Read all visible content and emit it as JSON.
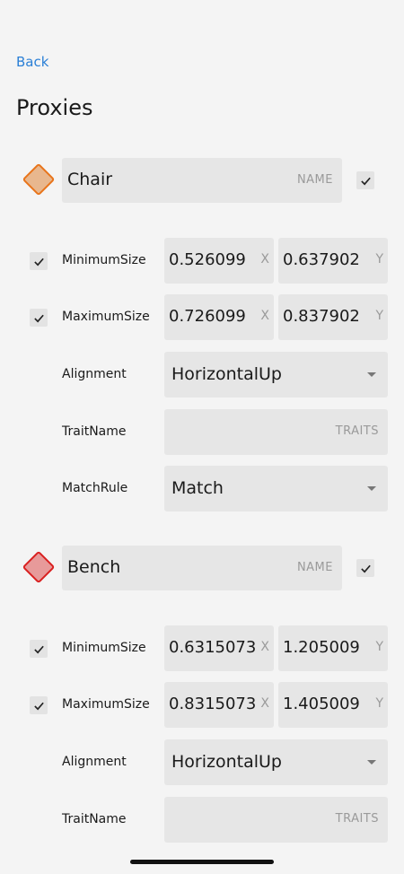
{
  "nav": {
    "back_label": "Back"
  },
  "page": {
    "title": "Proxies"
  },
  "proxies": [
    {
      "name": "Chair",
      "name_placeholder": "NAME",
      "color": "#e8b78e",
      "border_color": "#e8741a",
      "enabled": true,
      "minimum_size": {
        "enabled": true,
        "label": "MinimumSize",
        "x": "0.526099",
        "y": "0.637902",
        "x_axis": "X",
        "y_axis": "Y"
      },
      "maximum_size": {
        "enabled": true,
        "label": "MaximumSize",
        "x": "0.726099",
        "y": "0.837902",
        "x_axis": "X",
        "y_axis": "Y"
      },
      "alignment": {
        "label": "Alignment",
        "value": "HorizontalUp"
      },
      "trait_name": {
        "label": "TraitName",
        "value": "",
        "placeholder": "TRAITS"
      },
      "match_rule": {
        "label": "MatchRule",
        "value": "Match"
      }
    },
    {
      "name": "Bench",
      "name_placeholder": "NAME",
      "color": "#e79a9a",
      "border_color": "#d92020",
      "enabled": true,
      "minimum_size": {
        "enabled": true,
        "label": "MinimumSize",
        "x": "0.6315073",
        "y": "1.205009",
        "x_axis": "X",
        "y_axis": "Y"
      },
      "maximum_size": {
        "enabled": true,
        "label": "MaximumSize",
        "x": "0.8315073",
        "y": "1.405009",
        "x_axis": "X",
        "y_axis": "Y"
      },
      "alignment": {
        "label": "Alignment",
        "value": "HorizontalUp"
      },
      "trait_name": {
        "label": "TraitName",
        "value": "",
        "placeholder": "TRAITS"
      }
    }
  ]
}
